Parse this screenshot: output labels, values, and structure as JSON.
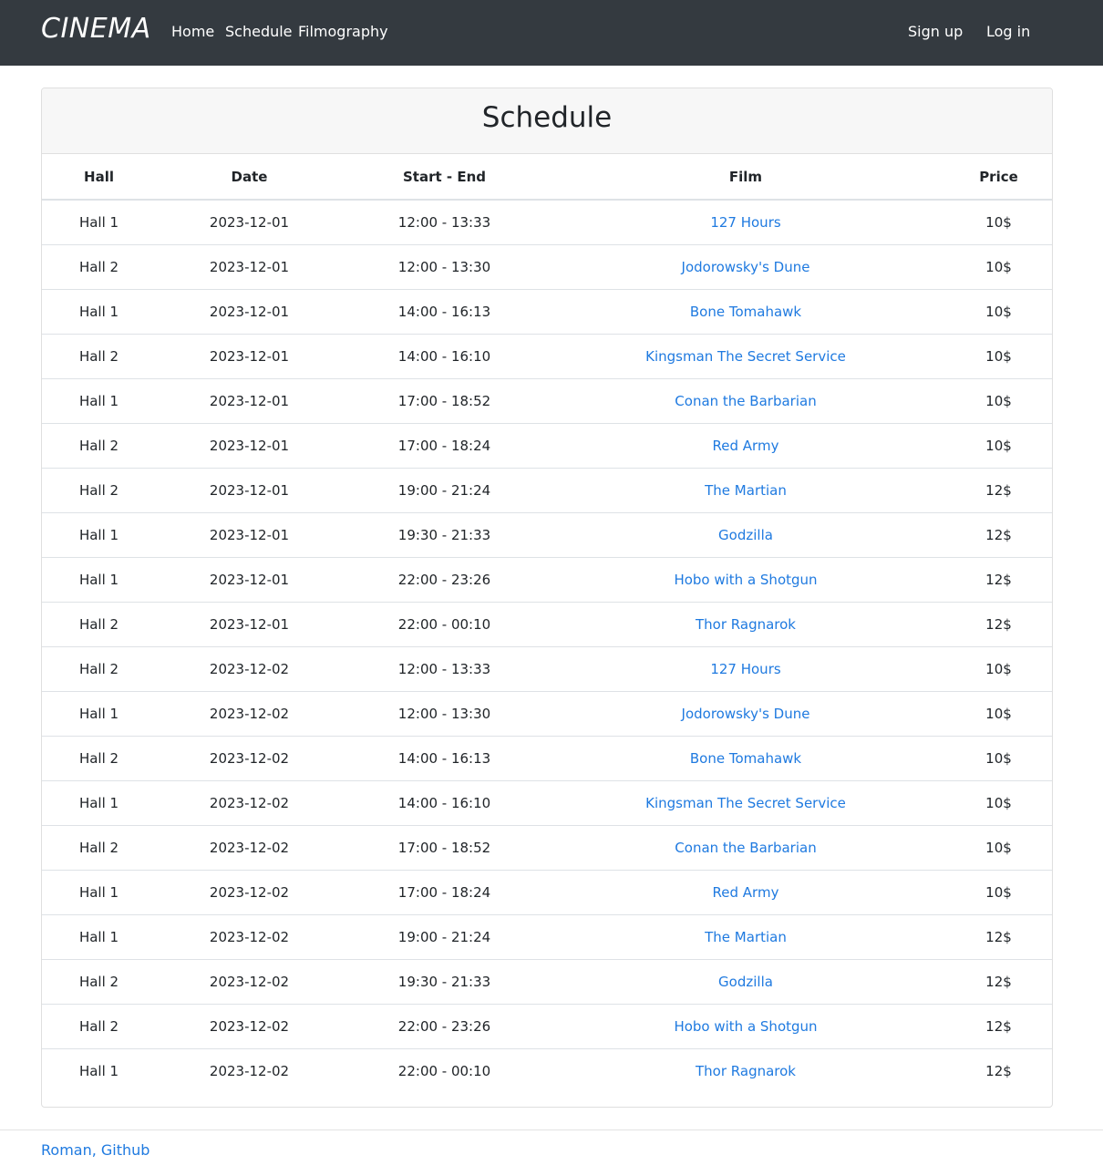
{
  "nav": {
    "brand": "CINEMA",
    "links": [
      "Home",
      "Schedule",
      "Filmography"
    ],
    "sign_up": "Sign up",
    "log_in": "Log in"
  },
  "schedule": {
    "title": "Schedule",
    "columns": [
      "Hall",
      "Date",
      "Start - End",
      "Film",
      "Price"
    ],
    "rows": [
      {
        "hall": "Hall 1",
        "date": "2023-12-01",
        "time": "12:00 - 13:33",
        "film": "127 Hours",
        "price": "10$"
      },
      {
        "hall": "Hall 2",
        "date": "2023-12-01",
        "time": "12:00 - 13:30",
        "film": "Jodorowsky's Dune",
        "price": "10$"
      },
      {
        "hall": "Hall 1",
        "date": "2023-12-01",
        "time": "14:00 - 16:13",
        "film": "Bone Tomahawk",
        "price": "10$"
      },
      {
        "hall": "Hall 2",
        "date": "2023-12-01",
        "time": "14:00 - 16:10",
        "film": "Kingsman The Secret Service",
        "price": "10$"
      },
      {
        "hall": "Hall 1",
        "date": "2023-12-01",
        "time": "17:00 - 18:52",
        "film": "Conan the Barbarian",
        "price": "10$"
      },
      {
        "hall": "Hall 2",
        "date": "2023-12-01",
        "time": "17:00 - 18:24",
        "film": "Red Army",
        "price": "10$"
      },
      {
        "hall": "Hall 2",
        "date": "2023-12-01",
        "time": "19:00 - 21:24",
        "film": "The Martian",
        "price": "12$"
      },
      {
        "hall": "Hall 1",
        "date": "2023-12-01",
        "time": "19:30 - 21:33",
        "film": "Godzilla",
        "price": "12$"
      },
      {
        "hall": "Hall 1",
        "date": "2023-12-01",
        "time": "22:00 - 23:26",
        "film": "Hobo with a Shotgun",
        "price": "12$"
      },
      {
        "hall": "Hall 2",
        "date": "2023-12-01",
        "time": "22:00 - 00:10",
        "film": "Thor Ragnarok",
        "price": "12$"
      },
      {
        "hall": "Hall 2",
        "date": "2023-12-02",
        "time": "12:00 - 13:33",
        "film": "127 Hours",
        "price": "10$"
      },
      {
        "hall": "Hall 1",
        "date": "2023-12-02",
        "time": "12:00 - 13:30",
        "film": "Jodorowsky's Dune",
        "price": "10$"
      },
      {
        "hall": "Hall 2",
        "date": "2023-12-02",
        "time": "14:00 - 16:13",
        "film": "Bone Tomahawk",
        "price": "10$"
      },
      {
        "hall": "Hall 1",
        "date": "2023-12-02",
        "time": "14:00 - 16:10",
        "film": "Kingsman The Secret Service",
        "price": "10$"
      },
      {
        "hall": "Hall 2",
        "date": "2023-12-02",
        "time": "17:00 - 18:52",
        "film": "Conan the Barbarian",
        "price": "10$"
      },
      {
        "hall": "Hall 1",
        "date": "2023-12-02",
        "time": "17:00 - 18:24",
        "film": "Red Army",
        "price": "10$"
      },
      {
        "hall": "Hall 1",
        "date": "2023-12-02",
        "time": "19:00 - 21:24",
        "film": "The Martian",
        "price": "12$"
      },
      {
        "hall": "Hall 2",
        "date": "2023-12-02",
        "time": "19:30 - 21:33",
        "film": "Godzilla",
        "price": "12$"
      },
      {
        "hall": "Hall 2",
        "date": "2023-12-02",
        "time": "22:00 - 23:26",
        "film": "Hobo with a Shotgun",
        "price": "12$"
      },
      {
        "hall": "Hall 1",
        "date": "2023-12-02",
        "time": "22:00 - 00:10",
        "film": "Thor Ragnarok",
        "price": "12$"
      }
    ]
  },
  "footer": {
    "credit": "Roman, Github"
  },
  "colors": {
    "navbar_bg": "#343a40",
    "link": "#1f7ae0",
    "card_header_bg": "#f7f7f7"
  }
}
